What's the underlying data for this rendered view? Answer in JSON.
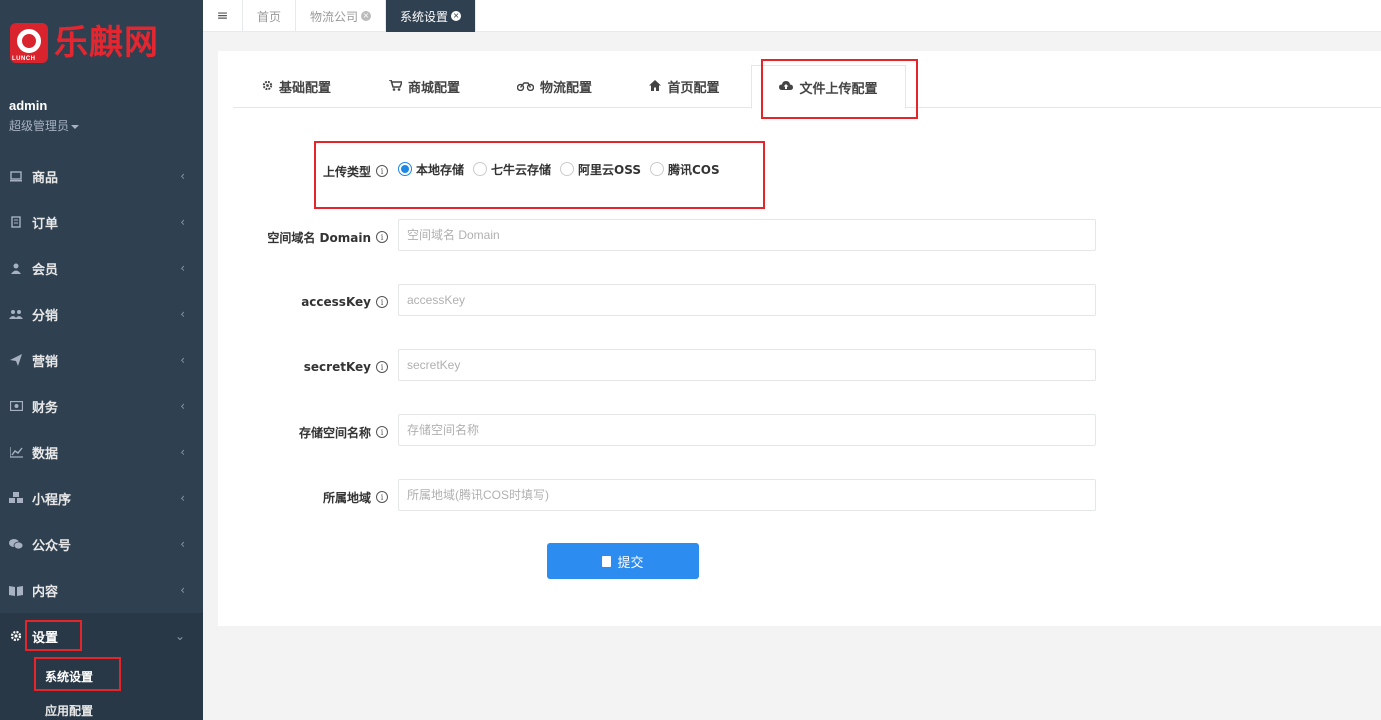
{
  "brand": {
    "logo_text": "乐麒网",
    "logo_sub": "LUNCH"
  },
  "user": {
    "name": "admin",
    "role": "超级管理员"
  },
  "sidebar": {
    "items": [
      {
        "label": "商品",
        "icon": "monitor-icon"
      },
      {
        "label": "订单",
        "icon": "clipboard-icon"
      },
      {
        "label": "会员",
        "icon": "user-icon"
      },
      {
        "label": "分销",
        "icon": "users-icon"
      },
      {
        "label": "营销",
        "icon": "paper-plane-icon"
      },
      {
        "label": "财务",
        "icon": "money-icon"
      },
      {
        "label": "数据",
        "icon": "line-chart-icon"
      },
      {
        "label": "小程序",
        "icon": "cubes-icon"
      },
      {
        "label": "公众号",
        "icon": "wechat-icon"
      },
      {
        "label": "内容",
        "icon": "book-icon"
      },
      {
        "label": "设置",
        "icon": "gear-icon"
      }
    ],
    "sub_items": [
      {
        "label": "系统设置"
      },
      {
        "label": "应用配置"
      }
    ]
  },
  "topbar": {
    "tabs": [
      {
        "label": "首页"
      },
      {
        "label": "物流公司"
      },
      {
        "label": "系统设置"
      }
    ]
  },
  "config_tabs": [
    {
      "label": "基础配置",
      "icon": "gear-icon"
    },
    {
      "label": "商城配置",
      "icon": "cart-icon"
    },
    {
      "label": "物流配置",
      "icon": "motorcycle-icon"
    },
    {
      "label": "首页配置",
      "icon": "home-icon"
    },
    {
      "label": "文件上传配置",
      "icon": "cloud-upload-icon"
    }
  ],
  "form": {
    "upload_type": {
      "label": "上传类型",
      "options": [
        {
          "label": "本地存储",
          "checked": true
        },
        {
          "label": "七牛云存储",
          "checked": false
        },
        {
          "label": "阿里云OSS",
          "checked": false
        },
        {
          "label": "腾讯COS",
          "checked": false
        }
      ]
    },
    "domain": {
      "label": "空间域名 Domain",
      "placeholder": "空间域名 Domain",
      "value": ""
    },
    "access_key": {
      "label": "accessKey",
      "placeholder": "accessKey",
      "value": ""
    },
    "secret_key": {
      "label": "secretKey",
      "placeholder": "secretKey",
      "value": ""
    },
    "bucket": {
      "label": "存储空间名称",
      "placeholder": "存储空间名称",
      "value": ""
    },
    "region": {
      "label": "所属地域",
      "placeholder": "所属地域(腾讯COS时填写)",
      "value": ""
    },
    "submit_label": "提交"
  },
  "colors": {
    "sidebar_bg": "#2f4050",
    "accent_blue": "#2d8cf0",
    "highlight_red": "#e5252a"
  }
}
